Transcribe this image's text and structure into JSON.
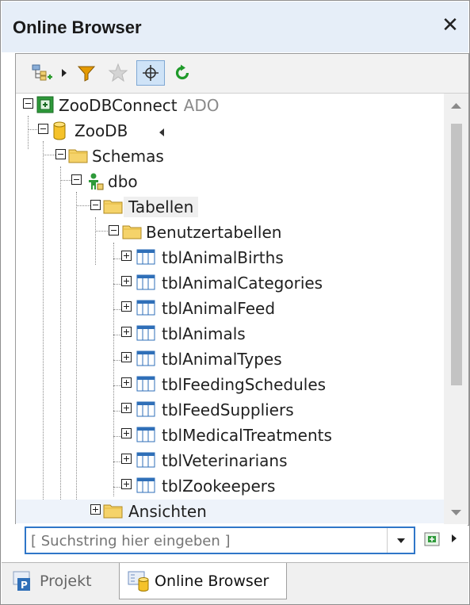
{
  "window": {
    "title": "Online Browser",
    "close_symbol": "✕"
  },
  "toolbar": {
    "buttons": [
      {
        "name": "add-connection-icon"
      },
      {
        "name": "filter-icon"
      },
      {
        "name": "favorites-star-icon"
      },
      {
        "name": "locate-icon",
        "pressed": true
      },
      {
        "name": "refresh-icon"
      }
    ]
  },
  "tree": {
    "connection": {
      "label": "ZooDBConnect",
      "suffix": "ADO"
    },
    "database": {
      "label": "ZooDB"
    },
    "schemas": {
      "label": "Schemas"
    },
    "schema": {
      "label": "dbo"
    },
    "tables_folder": {
      "label": "Tabellen"
    },
    "user_tables_folder": {
      "label": "Benutzertabellen"
    },
    "tables": [
      "tblAnimalBirths",
      "tblAnimalCategories",
      "tblAnimalFeed",
      "tblAnimals",
      "tblAnimalTypes",
      "tblFeedingSchedules",
      "tblFeedSuppliers",
      "tblMedicalTreatments",
      "tblVeterinarians",
      "tblZookeepers"
    ],
    "views_folder": {
      "label": "Ansichten"
    }
  },
  "search": {
    "placeholder": "[ Suchstring hier eingeben ]"
  },
  "tabs": [
    {
      "label": "Projekt",
      "active": false
    },
    {
      "label": "Online Browser",
      "active": true
    }
  ],
  "colors": {
    "titlebar_bg": "#e6eef8",
    "accent_blue": "#2f76c8",
    "folder_yellow": "#f5d36a",
    "refresh_green": "#1f9a2a",
    "filter_orange": "#e59a00"
  }
}
